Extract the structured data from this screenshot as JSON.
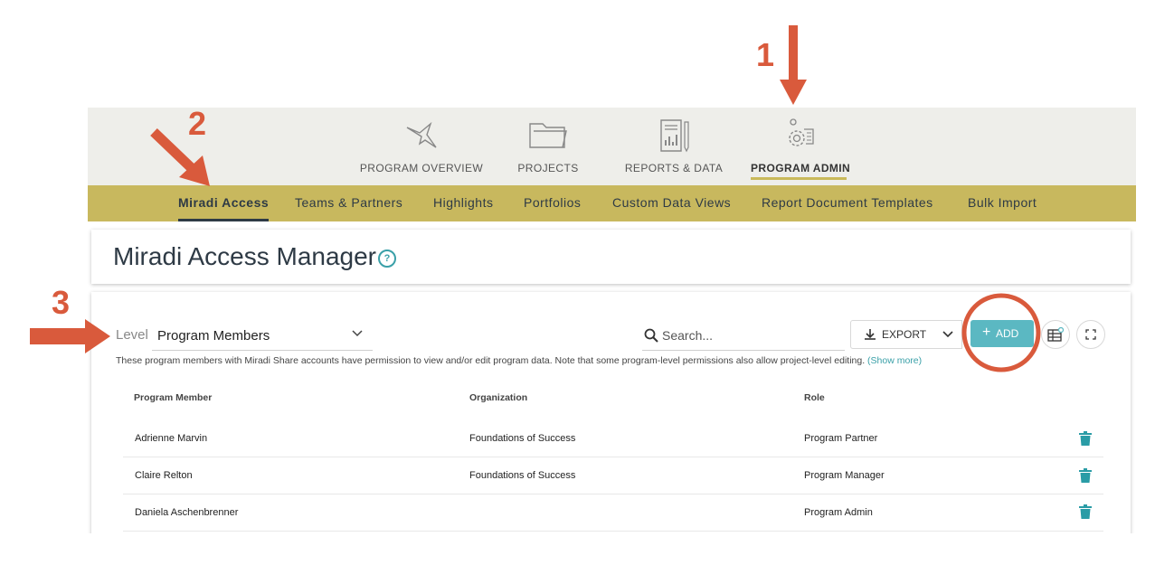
{
  "nav": {
    "tabs": [
      {
        "label": "PROGRAM OVERVIEW",
        "icon": "bird-icon"
      },
      {
        "label": "PROJECTS",
        "icon": "folder-icon"
      },
      {
        "label": "REPORTS & DATA",
        "icon": "report-icon"
      },
      {
        "label": "PROGRAM ADMIN",
        "icon": "admin-gear-icon",
        "active": true
      }
    ]
  },
  "subnav": {
    "items": [
      "Miradi Access",
      "Teams & Partners",
      "Highlights",
      "Portfolios",
      "Custom Data Views",
      "Report Document Templates",
      "Bulk Import"
    ],
    "active": "Miradi Access"
  },
  "page": {
    "title": "Miradi Access Manager",
    "help": "?"
  },
  "toolbar": {
    "level_label": "Level",
    "level_value": "Program Members",
    "search_placeholder": "Search...",
    "export_label": "EXPORT",
    "add_label": "ADD"
  },
  "description": {
    "text": "These program members with Miradi Share accounts have permission to view and/or edit program data. Note that some program-level permissions also allow project-level editing.",
    "more": "(Show more)"
  },
  "table": {
    "headers": [
      "Program Member",
      "Organization",
      "Role"
    ],
    "rows": [
      {
        "member": "Adrienne Marvin",
        "organization": "Foundations of Success",
        "role": "Program Partner"
      },
      {
        "member": "Claire Relton",
        "organization": "Foundations of Success",
        "role": "Program Manager"
      },
      {
        "member": "Daniela Aschenbrenner",
        "organization": "",
        "role": "Program Admin"
      }
    ]
  },
  "annotations": {
    "one": "1",
    "two": "2",
    "three": "3"
  },
  "colors": {
    "accent": "#5bb8c2",
    "subnav_bg": "#c8b85e",
    "annotation": "#d95a3c",
    "topbar_bg": "#eeeeea"
  }
}
